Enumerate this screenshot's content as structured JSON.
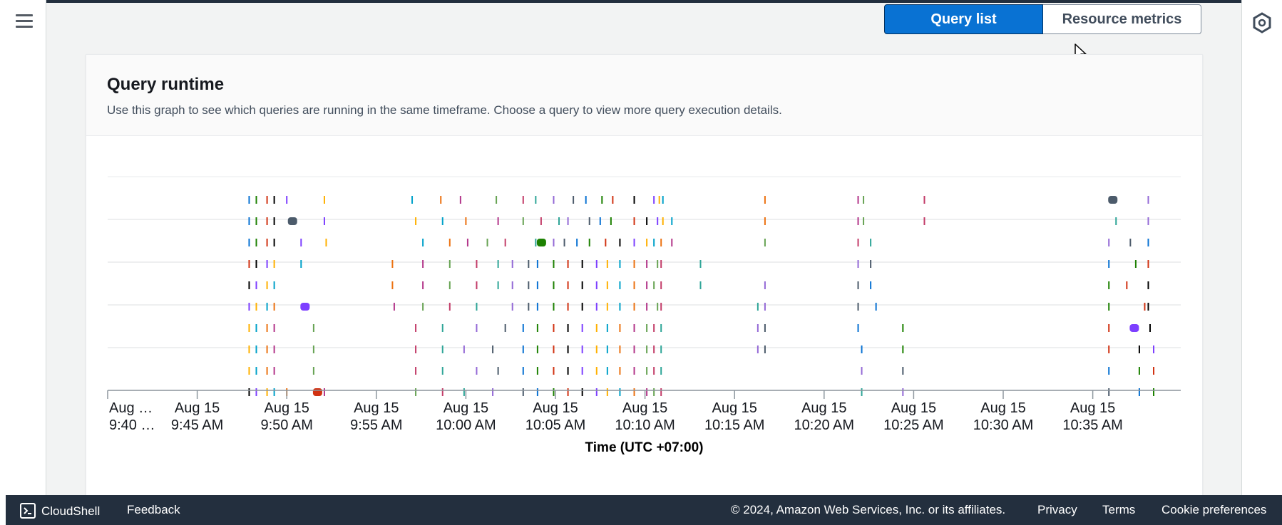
{
  "header": {
    "tabs": [
      {
        "label": "Query list",
        "active": true
      },
      {
        "label": "Resource metrics",
        "active": false
      }
    ],
    "menu_icon": "hamburger-menu-icon",
    "right_icon": "hexagon-help-icon"
  },
  "panel": {
    "title": "Query runtime",
    "description": "Use this graph to see which queries are running in the same timeframe. Choose a query to view more query execution details."
  },
  "chart_data": {
    "type": "scatter",
    "xlabel": "Time (UTC +07:00)",
    "x_ticks": [
      [
        "Aug …",
        "9:40 …"
      ],
      [
        "Aug 15",
        "9:45 AM"
      ],
      [
        "Aug 15",
        "9:50 AM"
      ],
      [
        "Aug 15",
        "9:55 AM"
      ],
      [
        "Aug 15",
        "10:00 AM"
      ],
      [
        "Aug 15",
        "10:05 AM"
      ],
      [
        "Aug 15",
        "10:10 AM"
      ],
      [
        "Aug 15",
        "10:15 AM"
      ],
      [
        "Aug 15",
        "10:20 AM"
      ],
      [
        "Aug 15",
        "10:25 AM"
      ],
      [
        "Aug 15",
        "10:30 AM"
      ],
      [
        "Aug 15",
        "10:35 AM"
      ]
    ],
    "xlim_minutes_after_940": [
      0,
      60
    ],
    "lanes": 10,
    "grid": true,
    "colors": [
      "#0972d3",
      "#1d8102",
      "#d13212",
      "#000000",
      "#7d3fff",
      "#ffb000",
      "#00a1c9",
      "#ec7211",
      "#b3368a",
      "#67a353",
      "#c33d69",
      "#2ea597",
      "#9469d6",
      "#4c5b6b"
    ],
    "queries": [
      {
        "lane": 0,
        "t": [
          7.9,
          8.3,
          8.9,
          9.3,
          10.0,
          12.1
        ],
        "big": []
      },
      {
        "lane": 0,
        "t": [
          17.0,
          18.6,
          19.7,
          21.7,
          23.2,
          23.9,
          24.9,
          26.0,
          26.7,
          27.6,
          28.2,
          29.4,
          30.5,
          30.8,
          31.0,
          36.7,
          41.9,
          42.2,
          45.6,
          56.1,
          58.1
        ],
        "big": [
          56.1
        ]
      },
      {
        "lane": 1,
        "t": [
          7.9,
          8.3,
          8.9,
          9.3,
          12.1,
          17.2,
          18.7,
          20.0,
          21.8,
          23.2,
          24.2,
          25.2,
          25.7,
          26.9,
          27.5,
          28.1,
          29.4,
          30.1,
          30.7,
          31.0,
          31.5,
          36.7,
          41.9,
          42.2,
          45.6,
          56.3,
          58.1
        ],
        "big": [
          10.3
        ]
      },
      {
        "lane": 2,
        "t": [
          7.9,
          8.3,
          8.9,
          9.3,
          10.8,
          12.2,
          17.6,
          19.1,
          20.1,
          21.2,
          22.2,
          23.9,
          24.9,
          25.5,
          26.2,
          26.9,
          27.8,
          28.6,
          29.4,
          30.1,
          30.5,
          30.9,
          31.5,
          36.7,
          41.9,
          42.6,
          55.9,
          57.1,
          58.1
        ],
        "big": [
          24.2
        ]
      },
      {
        "lane": 3,
        "t": [
          7.9,
          8.3,
          8.9,
          9.3,
          10.8,
          15.9,
          17.6,
          19.1,
          20.6,
          21.8,
          22.6,
          23.5,
          24.0,
          24.9,
          25.7,
          26.5,
          27.3,
          27.9,
          28.6,
          29.4,
          30.1,
          30.7,
          30.9,
          33.1,
          41.9,
          42.6,
          55.9,
          57.4,
          58.1
        ],
        "big": []
      },
      {
        "lane": 4,
        "t": [
          7.9,
          8.3,
          8.9,
          9.3,
          15.9,
          17.6,
          19.1,
          20.6,
          21.8,
          22.6,
          23.5,
          24.0,
          24.9,
          25.7,
          26.5,
          27.3,
          27.9,
          28.6,
          29.4,
          30.1,
          30.5,
          30.9,
          33.1,
          36.7,
          41.9,
          42.6,
          55.9,
          56.9,
          58.1
        ],
        "big": []
      },
      {
        "lane": 5,
        "t": [
          7.9,
          8.3,
          8.9,
          9.3,
          16.0,
          17.6,
          19.1,
          20.6,
          22.6,
          23.5,
          24.0,
          24.9,
          25.7,
          26.5,
          27.3,
          27.9,
          28.6,
          29.4,
          30.1,
          30.7,
          30.9,
          36.3,
          36.7,
          41.9,
          42.9,
          55.9,
          57.9,
          58.1
        ],
        "big": [
          11.0
        ]
      },
      {
        "lane": 6,
        "t": [
          7.9,
          8.3,
          8.9,
          9.3,
          11.5,
          17.2,
          18.7,
          20.6,
          22.2,
          23.2,
          24.0,
          24.9,
          25.7,
          26.5,
          27.3,
          27.9,
          28.6,
          29.4,
          30.1,
          30.5,
          30.9,
          36.3,
          36.7,
          41.9,
          44.4,
          55.9,
          58.2
        ],
        "big": [
          57.3
        ]
      },
      {
        "lane": 7,
        "t": [
          7.9,
          8.3,
          8.9,
          9.3,
          11.5,
          17.2,
          18.7,
          19.9,
          21.5,
          23.2,
          24.0,
          24.9,
          25.7,
          26.5,
          27.3,
          27.9,
          28.6,
          29.4,
          30.1,
          30.5,
          30.9,
          36.3,
          36.7,
          42.1,
          44.4,
          55.9,
          57.6,
          58.4
        ],
        "big": []
      },
      {
        "lane": 8,
        "t": [
          7.9,
          8.3,
          8.9,
          9.3,
          11.5,
          17.2,
          18.7,
          20.6,
          21.8,
          23.2,
          24.0,
          24.9,
          25.7,
          26.5,
          27.3,
          27.9,
          28.6,
          29.4,
          30.1,
          30.5,
          30.9,
          42.1,
          44.4,
          55.9,
          57.6,
          58.4
        ],
        "big": []
      },
      {
        "lane": 9,
        "t": [
          7.9,
          8.3,
          8.9,
          9.3,
          10.0,
          12.1,
          17.2,
          18.7,
          19.9,
          21.5,
          23.2,
          24.0,
          24.9,
          25.7,
          26.5,
          27.3,
          27.9,
          28.6,
          29.4,
          30.1,
          30.5,
          30.9,
          42.1,
          44.4,
          55.9,
          57.6,
          58.4
        ],
        "big": [
          11.7
        ]
      }
    ]
  },
  "footer": {
    "cloudshell": "CloudShell",
    "feedback": "Feedback",
    "copyright": "© 2024, Amazon Web Services, Inc. or its affiliates.",
    "privacy": "Privacy",
    "terms": "Terms",
    "cookies": "Cookie preferences"
  }
}
